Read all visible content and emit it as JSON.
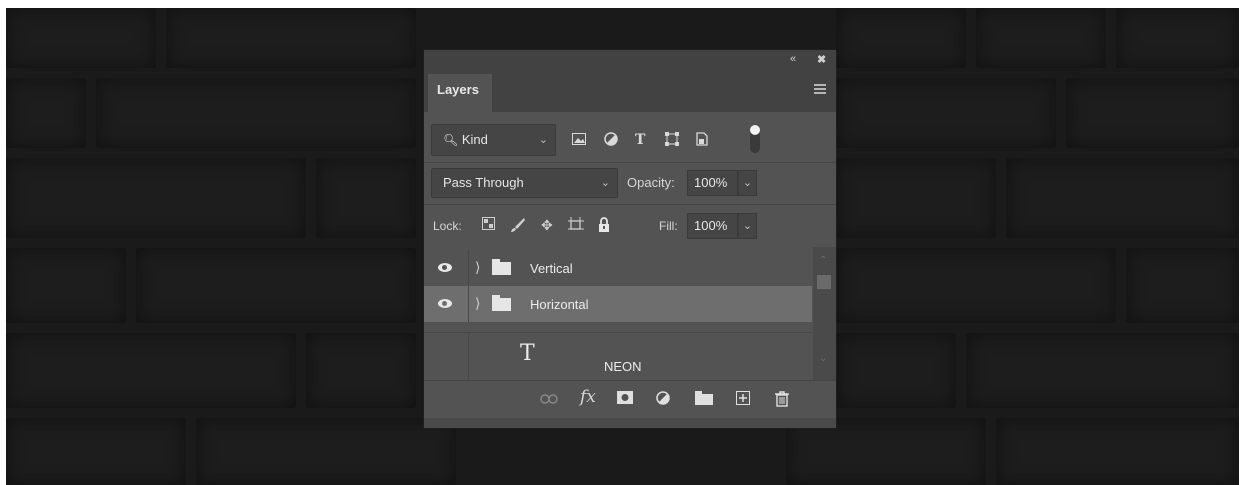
{
  "panel": {
    "collapse_icon": "double-chevron-left-icon",
    "close_icon": "close-icon",
    "tab_label": "Layers",
    "menu_icon": "panel-menu-icon"
  },
  "filter": {
    "kind_label": "Kind",
    "icons": [
      "pixel-layer-filter-icon",
      "adjustment-layer-filter-icon",
      "type-layer-filter-icon",
      "shape-layer-filter-icon",
      "smart-object-filter-icon",
      "filter-toggle-icon"
    ]
  },
  "blend": {
    "mode": "Pass Through",
    "opacity_label": "Opacity:",
    "opacity_value": "100%"
  },
  "lock": {
    "label": "Lock:",
    "icons": [
      "lock-transparent-pixels-icon",
      "lock-image-pixels-icon",
      "lock-position-icon",
      "lock-artboard-icon",
      "lock-all-icon"
    ],
    "fill_label": "Fill:",
    "fill_value": "100%"
  },
  "layers": [
    {
      "name": "Vertical",
      "type": "group",
      "visible": true,
      "selected": false
    },
    {
      "name": "Horizontal",
      "type": "group",
      "visible": true,
      "selected": true
    },
    {
      "name": "NEON",
      "type": "text",
      "visible": false,
      "selected": false
    }
  ],
  "bottom_icons": [
    "link-layers-icon",
    "fx-icon",
    "add-mask-icon",
    "new-fill-adjustment-icon",
    "new-group-icon",
    "new-layer-icon",
    "delete-icon"
  ]
}
